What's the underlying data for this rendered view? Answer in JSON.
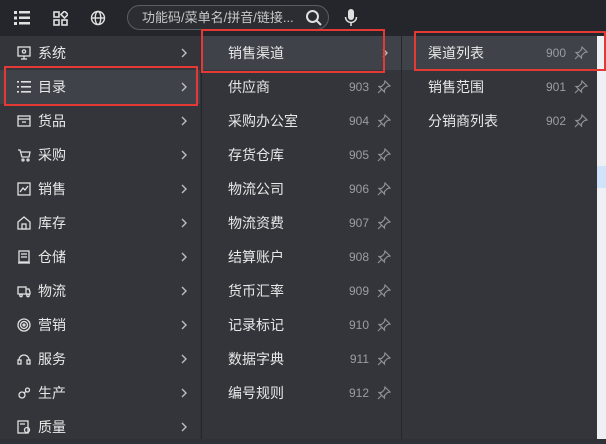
{
  "toolbar": {
    "search_placeholder": "功能码/菜单名/拼音/链接...",
    "icons": [
      "list-icon",
      "apps-icon",
      "globe-icon",
      "search-icon",
      "microphone-icon"
    ]
  },
  "menu": {
    "level1": [
      {
        "label": "系统",
        "icon": "monitor-icon"
      },
      {
        "label": "目录",
        "icon": "list-icon"
      },
      {
        "label": "货品",
        "icon": "box-icon"
      },
      {
        "label": "采购",
        "icon": "cart-icon"
      },
      {
        "label": "销售",
        "icon": "sales-icon"
      },
      {
        "label": "库存",
        "icon": "warehouse-icon"
      },
      {
        "label": "仓储",
        "icon": "storage-icon"
      },
      {
        "label": "物流",
        "icon": "truck-icon"
      },
      {
        "label": "营销",
        "icon": "target-icon"
      },
      {
        "label": "服务",
        "icon": "service-icon"
      },
      {
        "label": "生产",
        "icon": "gear-icon"
      },
      {
        "label": "质量",
        "icon": "quality-icon"
      }
    ],
    "level2": [
      {
        "label": "销售渠道",
        "code": ""
      },
      {
        "label": "供应商",
        "code": "903"
      },
      {
        "label": "采购办公室",
        "code": "904"
      },
      {
        "label": "存货仓库",
        "code": "905"
      },
      {
        "label": "物流公司",
        "code": "906"
      },
      {
        "label": "物流资费",
        "code": "907"
      },
      {
        "label": "结算账户",
        "code": "908"
      },
      {
        "label": "货币汇率",
        "code": "909"
      },
      {
        "label": "记录标记",
        "code": "910"
      },
      {
        "label": "数据字典",
        "code": "911"
      },
      {
        "label": "编号规则",
        "code": "912"
      }
    ],
    "level3": [
      {
        "label": "渠道列表",
        "code": "900"
      },
      {
        "label": "销售范围",
        "code": "901"
      },
      {
        "label": "分销商列表",
        "code": "902"
      }
    ]
  },
  "colors": {
    "background": "#33353b",
    "topbar": "#24262b",
    "highlight_border": "#e53935",
    "text": "#e8e8e8",
    "code_text": "#9a9da3"
  }
}
